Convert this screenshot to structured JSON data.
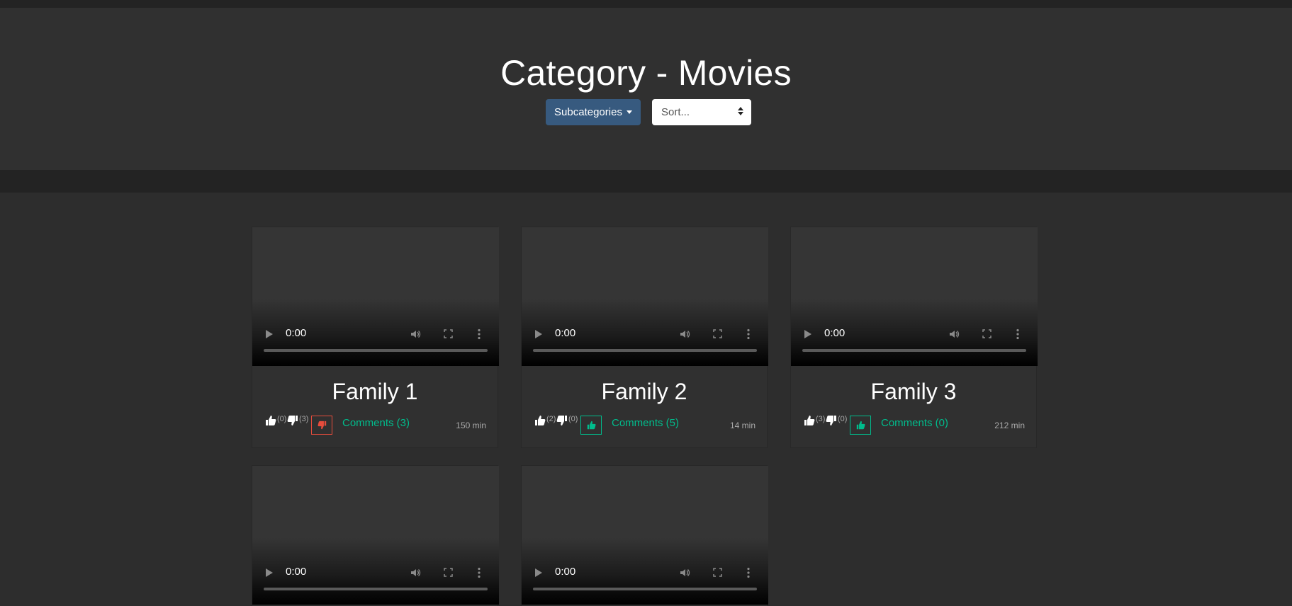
{
  "header": {
    "title": "Category - Movies",
    "subcategories_label": "Subcategories",
    "sort_placeholder": "Sort..."
  },
  "colors": {
    "accent_blue": "#375a7f",
    "success_green": "#00bc8c",
    "danger_red": "#e74c3c",
    "background": "#2d2d2d"
  },
  "cards": [
    {
      "title": "Family 1",
      "time": "0:00",
      "likes": "(0)",
      "dislikes": "(3)",
      "vote": "down",
      "comments": "Comments (3)",
      "duration": "150 min"
    },
    {
      "title": "Family 2",
      "time": "0:00",
      "likes": "(2)",
      "dislikes": "(0)",
      "vote": "up",
      "comments": "Comments (5)",
      "duration": "14 min"
    },
    {
      "title": "Family 3",
      "time": "0:00",
      "likes": "(3)",
      "dislikes": "(0)",
      "vote": "up",
      "comments": "Comments (0)",
      "duration": "212 min"
    },
    {
      "time": "0:00"
    },
    {
      "time": "0:00"
    }
  ]
}
